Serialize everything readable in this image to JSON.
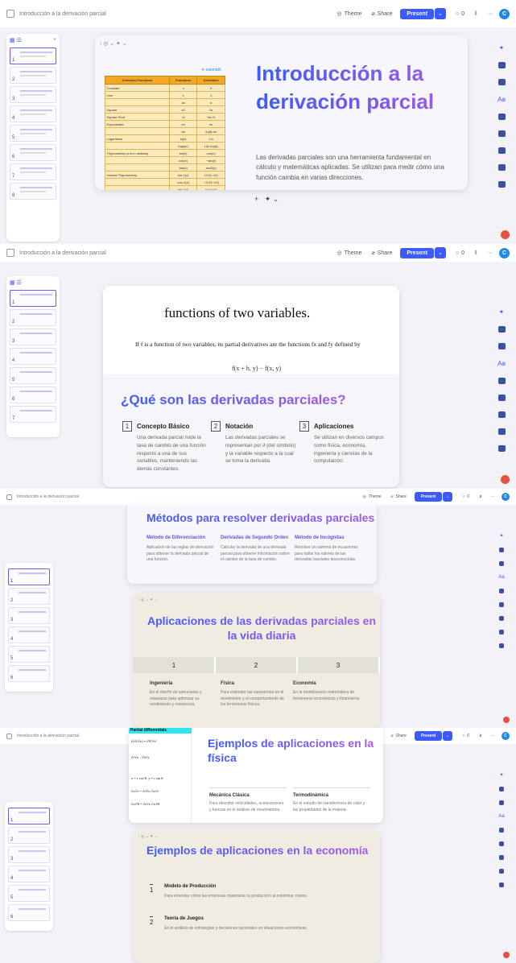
{
  "topbar": {
    "breadcrumb": "Introducción a la derivación parcial",
    "theme": "Theme",
    "share": "Share",
    "present": "Present",
    "comments_count": "0",
    "avatar_initial": "C"
  },
  "accent": "#3b5bff",
  "thumbnails": [
    "1",
    "2",
    "3",
    "4",
    "5",
    "6",
    "7",
    "8"
  ],
  "slide1": {
    "title": "Introducción a la derivación parcial",
    "body": "Las derivadas parciales son una herramienta fundamental en cálculo y matemáticas aplicadas. Se utilizan para medir cómo una función cambia en varias direcciones.",
    "table_headers": [
      "Common Functions",
      "Functions",
      "Derivative"
    ],
    "table_rows": [
      [
        "Constant",
        "c",
        "0"
      ],
      [
        "Line",
        "x",
        "1"
      ],
      [
        "",
        "ax",
        "a"
      ],
      [
        "Square",
        "x2",
        "2x"
      ],
      [
        "Square Root",
        "√x",
        "½x-½"
      ],
      [
        "Exponential",
        "ex",
        "ex"
      ],
      [
        "",
        "ax",
        "ln(a) ax"
      ],
      [
        "Logarithms",
        "ln(x)",
        "1/x"
      ],
      [
        "",
        "loga(x)",
        "1/(x ln(a))"
      ],
      [
        "Trigonometry (x is in radians)",
        "sin(x)",
        "cos(x)"
      ],
      [
        "",
        "cos(x)",
        "−sin(x)"
      ],
      [
        "",
        "tan(x)",
        "sec2(x)"
      ],
      [
        "Inverse Trigonometry",
        "sin-1(x)",
        "1/√(1−x2)"
      ],
      [
        "",
        "cos-1(x)",
        "−1/√(1−x2)"
      ],
      [
        "",
        "tan-1(x)",
        "1/(1+x2)"
      ]
    ],
    "add_label": "+"
  },
  "slide2": {
    "book_line": "functions of two variables.",
    "book_def": "If f is a function of two variables, its partial derivatives are the functions fx and fy defined by",
    "book_formula": "f(x + h, y) − f(x, y)",
    "title": "¿Qué son las derivadas parciales?",
    "columns": [
      {
        "num": "1",
        "heading": "Concepto Básico",
        "text": "Una derivada parcial mide la tasa de cambio de una función respecto a una de sus variables, manteniendo las demás constantes."
      },
      {
        "num": "2",
        "heading": "Notación",
        "text": "Las derivadas parciales se representan por ∂ (del símbolo) y la variable respecto a la cual se toma la derivada."
      },
      {
        "num": "3",
        "heading": "Aplicaciones",
        "text": "Se utilizan en diversos campos como física, economía, ingeniería y ciencias de la computación."
      }
    ]
  },
  "slide3": {
    "title": "Métodos para resolver derivadas parciales",
    "methods": [
      {
        "heading": "Método de Diferenciación",
        "text": "Aplicación de las reglas de derivación para obtener la derivada parcial de una función."
      },
      {
        "heading": "Derivadas de Segundo Orden",
        "text": "Calcular la derivada de una derivada parcial para obtener información sobre el cambio de la tasa de cambio."
      },
      {
        "heading": "Método de Incógnitas",
        "text": "Resolver un sistema de ecuaciones para hallar los valores de las derivadas parciales desconocidas."
      }
    ]
  },
  "slide4": {
    "title": "Aplicaciones de las derivadas parciales en la vida diaria",
    "steps": [
      "1",
      "2",
      "3"
    ],
    "apps": [
      {
        "heading": "Ingeniería",
        "text": "En el diseño de estructuras y máquinas para optimizar su rendimiento y resistencia."
      },
      {
        "heading": "Física",
        "text": "Para entender las variaciones en el movimiento y el comportamiento de los fenómenos físicos."
      },
      {
        "heading": "Economía",
        "text": "En la modelización matemática de fenómenos económicos y financieros."
      }
    ]
  },
  "slide5": {
    "image_caption": "Partial differentials",
    "title": "Ejemplos de aplicaciones en la física",
    "cols": [
      {
        "heading": "Mecánica Clásica",
        "text": "Para describir velocidades, aceleraciones y fuerzas en el análisis de movimientos."
      },
      {
        "heading": "Termodinámica",
        "text": "En el estudio de transferencia de calor y las propiedades de la materia."
      }
    ]
  },
  "slide6": {
    "title": "Ejemplos de aplicaciones en la economía",
    "items": [
      {
        "num": "1",
        "heading": "Modelo de Producción",
        "text": "Para entender cómo las empresas maximizan la producción al minimizar costos."
      },
      {
        "num": "2",
        "heading": "Teoría de Juegos",
        "text": "En el análisis de estrategias y decisiones racionales en situaciones económicas."
      }
    ]
  }
}
